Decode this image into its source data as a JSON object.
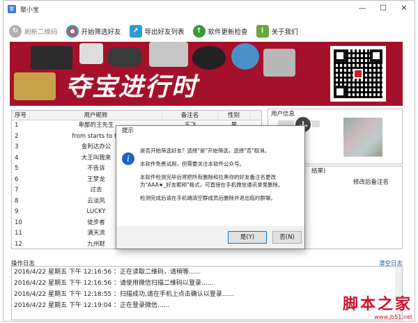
{
  "window": {
    "title": "聚小宝"
  },
  "titlebar": {
    "minimize": "—",
    "maximize": "☐",
    "close": "✕",
    "icon_letter": "聚"
  },
  "toolbar": {
    "buttons": [
      {
        "label": "刷新二维码",
        "icon": "refresh-qr-icon",
        "color": "#b0b0b0"
      },
      {
        "label": "开始筛选好友",
        "icon": "start-filter-icon",
        "color": "#3e8ed0"
      },
      {
        "label": "导出好友列表",
        "icon": "export-icon",
        "color": "#2f9bd6"
      },
      {
        "label": "软件更新检查",
        "icon": "update-arrow-icon",
        "color": "#3a9a3a"
      },
      {
        "label": "关于我们",
        "icon": "info-icon",
        "color": "#6aa63a"
      }
    ]
  },
  "banner": {
    "slogan": "夺宝进行时",
    "bg": "#a5102a"
  },
  "table": {
    "headers": [
      "序号",
      "用户昵称",
      "备注名",
      "性别"
    ],
    "rows": [
      [
        "1",
        "卑鄙的王先生",
        "王飞",
        "男"
      ],
      [
        "2",
        "from starts to th",
        "",
        ""
      ],
      [
        "3",
        "金利达办公",
        "",
        ""
      ],
      [
        "4",
        "大王叫我来",
        "",
        ""
      ],
      [
        "5",
        "不告诉",
        "",
        ""
      ],
      [
        "6",
        "王梦龙",
        "",
        ""
      ],
      [
        "7",
        "过去",
        "",
        ""
      ],
      [
        "8",
        "云淡风",
        "",
        ""
      ],
      [
        "9",
        "LUCKY",
        "",
        ""
      ],
      [
        "10",
        "徒步者",
        "",
        ""
      ],
      [
        "11",
        "满天流",
        "",
        ""
      ],
      [
        "12",
        "九州财",
        "",
        ""
      ]
    ]
  },
  "userinfo": {
    "label": "用户信息"
  },
  "result": {
    "label_suffix": "结果)",
    "col_header": "修改后备注名"
  },
  "dialog": {
    "title": "提示",
    "paragraphs": [
      "是否开始筛选好友？选择\"是\"开始筛选，选择\"否\"取消。",
      "本软件免费试用，但需要关注本软件公众号。",
      "本软件检测完毕后将把所有删除和拉黑你的好友备注名更改为\"AAA★_好友昵称\"格式，可直接在手机微信通讯录里删除。",
      "检测完成后请在手机端清空群成员后删除并退出临时群聊。"
    ],
    "yes": "是(Y)",
    "no": "否(N)"
  },
  "log": {
    "label": "操作日志",
    "clear": "清空日志",
    "lines": [
      "2016/4/22 星期五 下午 12:16:56 ：正在读取二维码，请稍等......",
      "2016/4/22 星期五 下午 12:16:56 ：请使用微信扫描二维码以登录......",
      "2016/4/22 星期五 下午 12:18:55 ：扫描成功,请在手机上点击确认以登录......",
      "2016/4/22 星期五 下午 12:19:04 ：正在登录微信......"
    ]
  },
  "watermark": {
    "main": "脚本之家",
    "sub": "www.jb51.net"
  }
}
